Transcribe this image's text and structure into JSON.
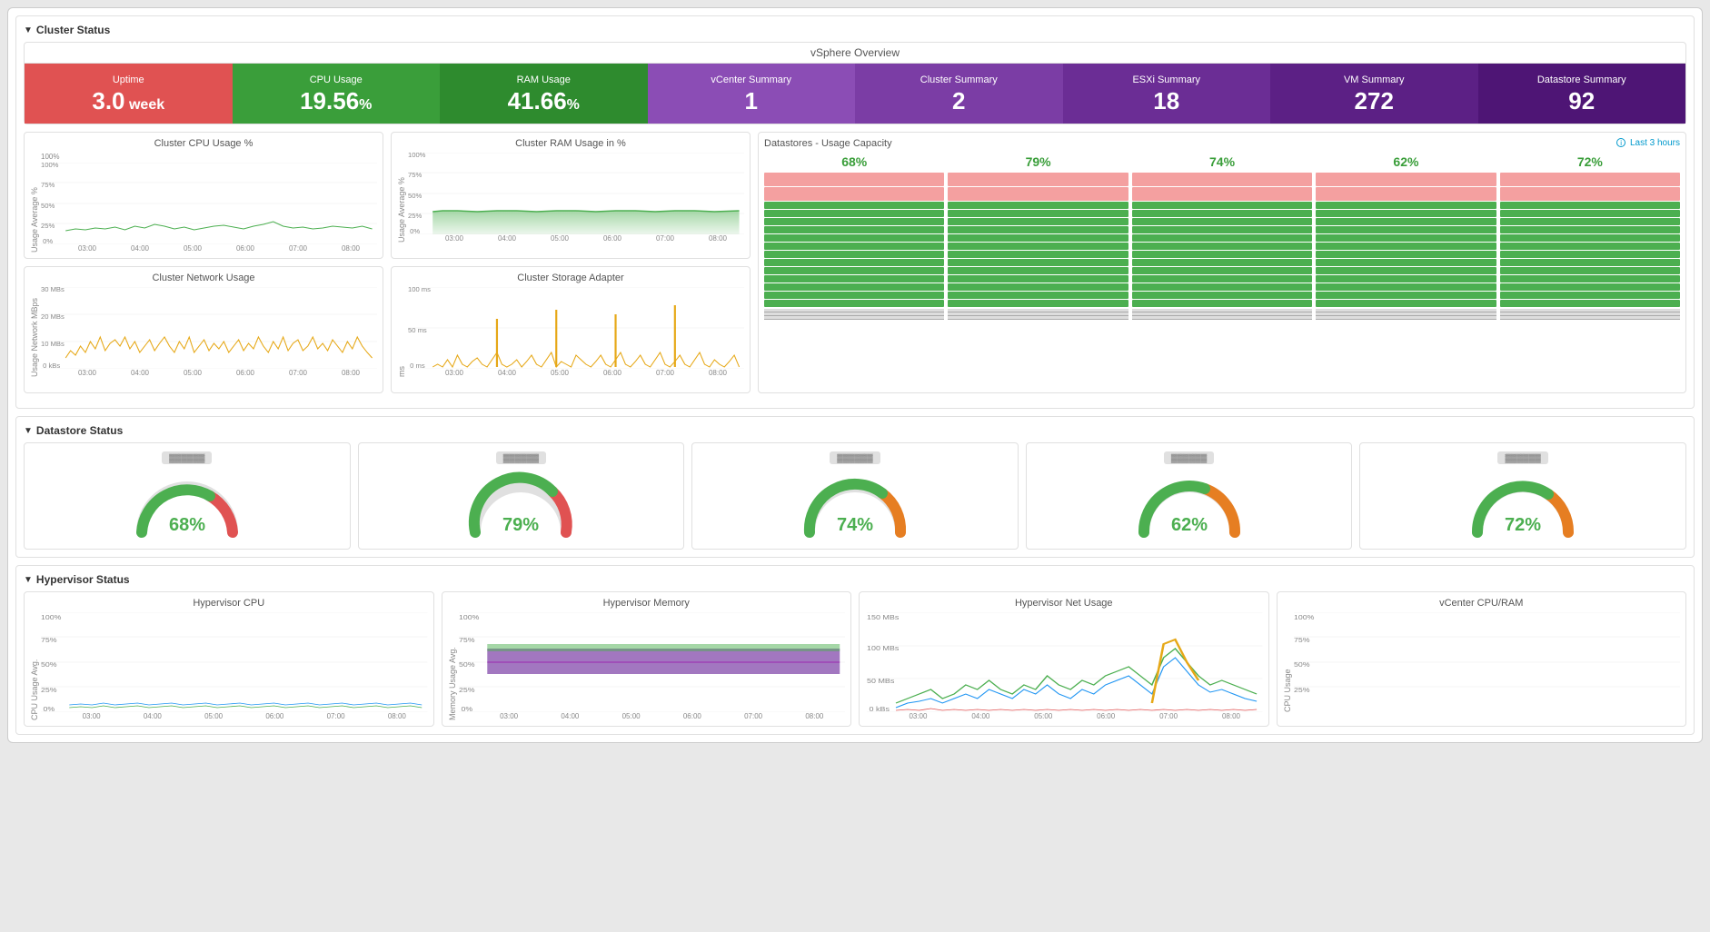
{
  "sections": {
    "cluster_status": "Cluster Status",
    "datastore_status": "Datastore Status",
    "hypervisor_status": "Hypervisor Status"
  },
  "vsphere": {
    "title": "vSphere Overview",
    "tiles": [
      {
        "id": "uptime",
        "label": "Uptime",
        "value": "3.0",
        "unit": " week",
        "color": "red"
      },
      {
        "id": "cpu_usage",
        "label": "CPU Usage",
        "value": "19.56",
        "unit": "%",
        "color": "green"
      },
      {
        "id": "ram_usage",
        "label": "RAM Usage",
        "value": "41.66",
        "unit": "%",
        "color": "dark-green"
      },
      {
        "id": "vcenter_summary",
        "label": "vCenter Summary",
        "value": "1",
        "unit": "",
        "color": "purple-light"
      },
      {
        "id": "cluster_summary",
        "label": "Cluster Summary",
        "value": "2",
        "unit": "",
        "color": "purple-mid"
      },
      {
        "id": "esxi_summary",
        "label": "ESXi Summary",
        "value": "18",
        "unit": "",
        "color": "purple-dark"
      },
      {
        "id": "vm_summary",
        "label": "VM Summary",
        "value": "272",
        "unit": "",
        "color": "purple-darker"
      },
      {
        "id": "datastore_summary",
        "label": "Datastore Summary",
        "value": "92",
        "unit": "",
        "color": "purple-darkest"
      }
    ]
  },
  "charts": {
    "cpu_usage": {
      "title": "Cluster CPU Usage %",
      "y_label": "Usage Average %",
      "y_ticks": [
        "100%",
        "75%",
        "50%",
        "25%",
        "0%"
      ],
      "x_ticks": [
        "03:00",
        "04:00",
        "05:00",
        "06:00",
        "07:00",
        "08:00"
      ]
    },
    "ram_usage": {
      "title": "Cluster RAM Usage in %",
      "y_label": "Usage Average %",
      "y_ticks": [
        "100%",
        "75%",
        "50%",
        "25%",
        "0%"
      ],
      "x_ticks": [
        "03:00",
        "04:00",
        "05:00",
        "06:00",
        "07:00",
        "08:00"
      ]
    },
    "network_usage": {
      "title": "Cluster Network Usage",
      "y_label": "Usage Network MBps",
      "y_ticks": [
        "30 MBs",
        "20 MBs",
        "10 MBs",
        "0 kBs"
      ],
      "x_ticks": [
        "03:00",
        "04:00",
        "05:00",
        "06:00",
        "07:00",
        "08:00"
      ]
    },
    "storage_adapter": {
      "title": "Cluster Storage Adapter",
      "y_label": "ms",
      "y_ticks": [
        "100 ms",
        "50 ms",
        "0 ms"
      ],
      "x_ticks": [
        "03:00",
        "04:00",
        "05:00",
        "06:00",
        "07:00",
        "08:00"
      ]
    }
  },
  "datastores": {
    "title": "Datastores - Usage Capacity",
    "last_label": "Last 3 hours",
    "columns": [
      {
        "pct": "68%",
        "red_pct": 8,
        "green_pct": 68
      },
      {
        "pct": "79%",
        "red_pct": 10,
        "green_pct": 79
      },
      {
        "pct": "74%",
        "red_pct": 9,
        "green_pct": 74
      },
      {
        "pct": "62%",
        "red_pct": 8,
        "green_pct": 62
      },
      {
        "pct": "72%",
        "red_pct": 9,
        "green_pct": 72
      }
    ]
  },
  "datastore_gauges": [
    {
      "label": "▓▓▓▓▓▓▓▓",
      "value": "68%",
      "color": "green"
    },
    {
      "label": "▓▓▓▓▓▓▓▓",
      "value": "79%",
      "color": "orange"
    },
    {
      "label": "▓▓▓▓▓▓▓▓",
      "value": "74%",
      "color": "orange"
    },
    {
      "label": "▓▓▓▓▓▓▓▓",
      "value": "62%",
      "color": "green"
    },
    {
      "label": "▓▓▓▓▓▓▓▓",
      "value": "72%",
      "color": "orange"
    }
  ],
  "hypervisor_charts": {
    "cpu": {
      "title": "Hypervisor CPU",
      "y_label": "CPU Usage Avg.",
      "y_ticks": [
        "100%",
        "75%",
        "50%",
        "25%",
        "0%"
      ],
      "x_ticks": [
        "03:00",
        "04:00",
        "05:00",
        "06:00",
        "07:00",
        "08:00"
      ]
    },
    "memory": {
      "title": "Hypervisor Memory",
      "y_label": "Memory Usage Avg.",
      "y_ticks": [
        "100%",
        "75%",
        "50%",
        "25%",
        "0%"
      ],
      "x_ticks": [
        "03:00",
        "04:00",
        "05:00",
        "06:00",
        "07:00",
        "08:00"
      ]
    },
    "net_usage": {
      "title": "Hypervisor Net Usage",
      "y_label": "",
      "y_ticks": [
        "150 MBs",
        "100 MBs",
        "50 MBs",
        "0 kBs"
      ],
      "x_ticks": [
        "03:00",
        "04:00",
        "05:00",
        "06:00",
        "07:00",
        "08:00"
      ]
    },
    "vcenter_cpu_ram": {
      "title": "vCenter CPU/RAM",
      "y_label": "CPU Usage",
      "y_ticks": [
        "100%",
        "75%",
        "50%",
        "25%"
      ],
      "x_ticks": []
    }
  }
}
